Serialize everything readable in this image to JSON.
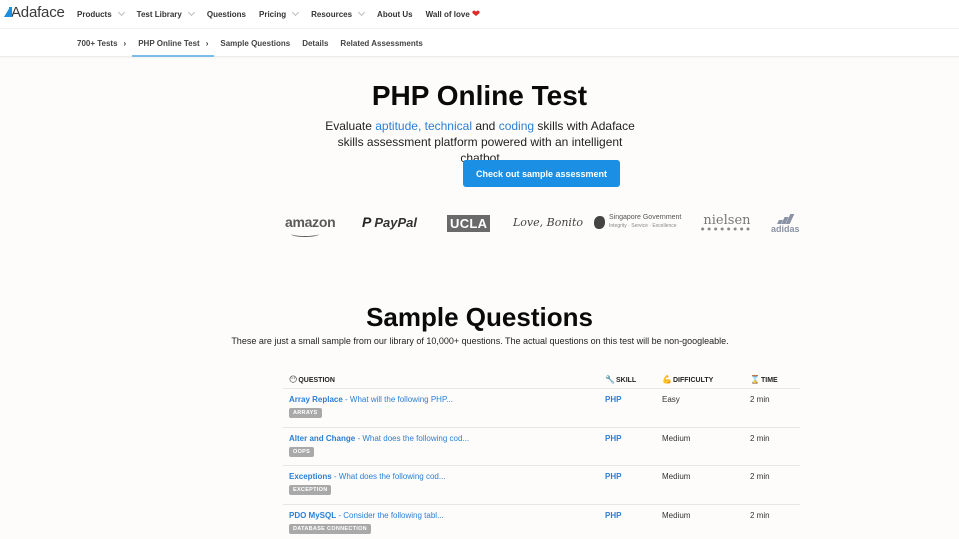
{
  "topnav": {
    "logo": "Adaface",
    "items": [
      {
        "label": "Products",
        "has_dropdown": true
      },
      {
        "label": "Test Library",
        "has_dropdown": true
      },
      {
        "label": "Questions",
        "has_dropdown": false
      },
      {
        "label": "Pricing",
        "has_dropdown": true
      },
      {
        "label": "Resources",
        "has_dropdown": true
      },
      {
        "label": "About Us",
        "has_dropdown": false
      },
      {
        "label": "Wall of love",
        "has_dropdown": false,
        "icon": "heart-icon"
      }
    ]
  },
  "subnav": {
    "items": [
      {
        "label": "700+ Tests",
        "arrow": "›"
      },
      {
        "label": "PHP Online Test",
        "arrow": "›",
        "active": true
      },
      {
        "label": "Sample Questions"
      },
      {
        "label": "Details"
      },
      {
        "label": "Related Assessments"
      }
    ]
  },
  "hero": {
    "title": "PHP Online Test",
    "sub_prefix": "Evaluate ",
    "sub_hl1": "aptitude, technical",
    "sub_mid": " and ",
    "sub_hl2": "coding",
    "sub_suffix": " skills with Adaface skills assessment platform powered with an intelligent chatbot",
    "cta": "Check out sample assessment",
    "accent": "#1a8fe3"
  },
  "logos": {
    "amazon": "amazon",
    "paypal": "PayPal",
    "ucla": "UCLA",
    "love_bonito": "Love, Bonito",
    "sg_gov": "Singapore Government",
    "sg_gov_tagline": "Integrity · Service · Excellence",
    "nielsen": "nielsen",
    "adidas": "adidas"
  },
  "sample_questions": {
    "title": "Sample Questions",
    "subtitle": "These are just a small sample from our library of 10,000+ questions. The actual questions on this test will be non-googleable.",
    "headers": {
      "question": "QUESTION",
      "skill": "SKILL",
      "difficulty": "DIFFICULTY",
      "time": "TIME"
    },
    "rows": [
      {
        "title": "Array Replace",
        "snippet": " - What will the following PHP...",
        "tag": "ARRAYS",
        "skill": "PHP",
        "difficulty": "Easy",
        "time": "2 min"
      },
      {
        "title": "Alter and Change",
        "snippet": " - What does the following cod...",
        "tag": "OOPS",
        "skill": "PHP",
        "difficulty": "Medium",
        "time": "2 min"
      },
      {
        "title": "Exceptions",
        "snippet": " - What does the following cod...",
        "tag": "EXCEPTION",
        "skill": "PHP",
        "difficulty": "Medium",
        "time": "2 min"
      },
      {
        "title": "PDO MySQL",
        "snippet": " - Consider the following tabl...",
        "tag": "DATABASE CONNECTION",
        "skill": "PHP",
        "difficulty": "Medium",
        "time": "2 min"
      }
    ]
  }
}
